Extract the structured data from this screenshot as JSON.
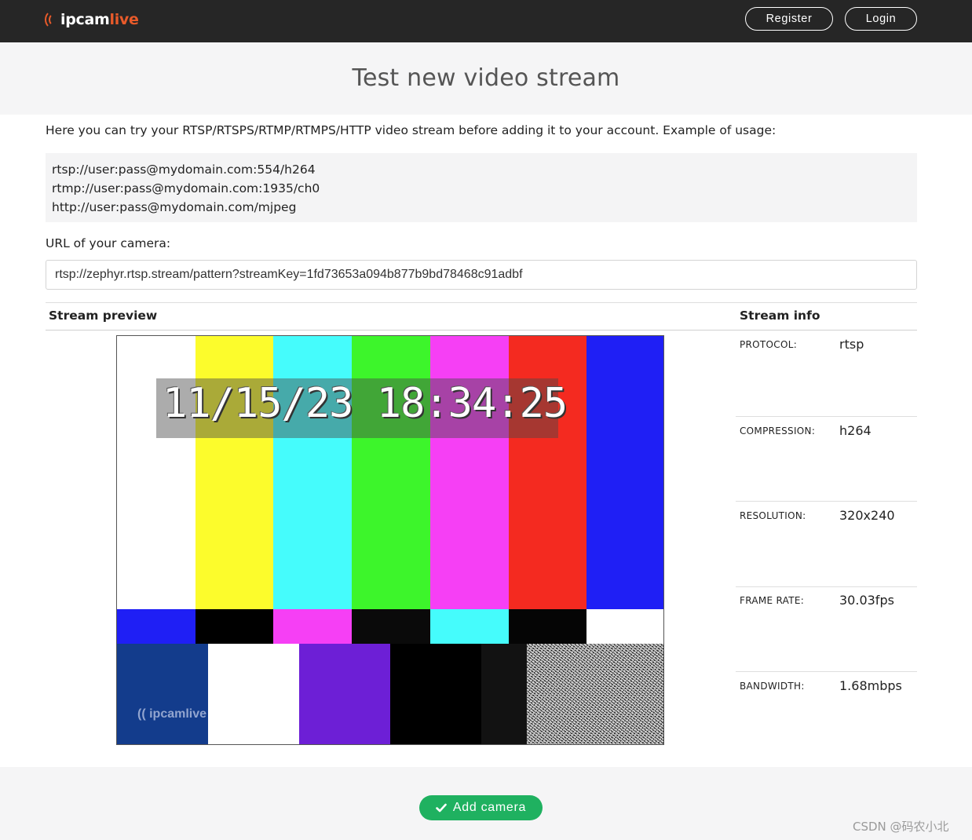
{
  "header": {
    "logo_part1": "ipcam",
    "logo_part2": "live",
    "register_label": "Register",
    "login_label": "Login"
  },
  "page_title": "Test new video stream",
  "intro_text": "Here you can try your RTSP/RTSPS/RTMP/RTMPS/HTTP video stream before adding it to your account. Example of usage:",
  "examples": [
    "rtsp://user:pass@mydomain.com:554/h264",
    "rtmp://user:pass@mydomain.com:1935/ch0",
    "http://user:pass@mydomain.com/mjpeg"
  ],
  "url_label": "URL of your camera:",
  "url_value": "rtsp://zephyr.rtsp.stream/pattern?streamKey=1fd73653a094b877b9bd78468c91adbf",
  "table": {
    "preview_header": "Stream preview",
    "info_header": "Stream info"
  },
  "video": {
    "timestamp": "11/15/23 18:34:25",
    "watermark": "ipcamlive",
    "top_bars": [
      "#ffffff",
      "#fcfc2c",
      "#45fcfc",
      "#3df52b",
      "#f63ff5",
      "#f42a20",
      "#1f1ff5"
    ],
    "mid_bars": [
      "#1f1ff5",
      "#000000",
      "#f63ff5",
      "#0a0a0a",
      "#45fcfc",
      "#050505",
      "#ffffff"
    ],
    "bottom_bars": [
      "#133c8c",
      "#ffffff",
      "#6d1fd6",
      "#000000",
      "#121212"
    ]
  },
  "stream_info": [
    {
      "label": "PROTOCOL:",
      "value": "rtsp"
    },
    {
      "label": "COMPRESSION:",
      "value": "h264"
    },
    {
      "label": "RESOLUTION:",
      "value": "320x240"
    },
    {
      "label": "FRAME RATE:",
      "value": "30.03fps"
    },
    {
      "label": "BANDWIDTH:",
      "value": "1.68mbps"
    }
  ],
  "add_camera_label": "Add camera",
  "watermark_text": "CSDN @码农小北",
  "colors": {
    "topbar": "#262626",
    "brand_orange": "#e85a2a",
    "add_button": "#1fb160"
  }
}
